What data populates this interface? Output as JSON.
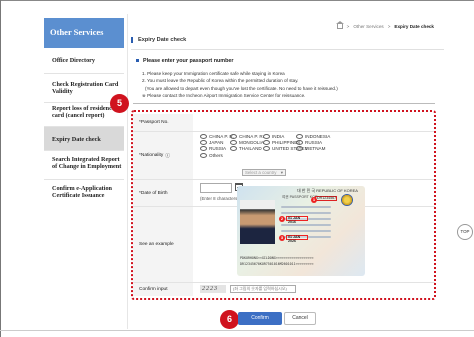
{
  "sidebar": {
    "title": "Other Services",
    "items": [
      {
        "label": "Office Directory"
      },
      {
        "label": "Check Registration Card Validity"
      },
      {
        "label": "Report loss of residence card (cancel report)"
      },
      {
        "label": "Expiry Date check",
        "active": true
      },
      {
        "label": "Search Integrated Report of Change in Employment"
      },
      {
        "label": "Confirm e-Application Certificate Issuance"
      }
    ]
  },
  "breadcrumb": {
    "sep1": ">",
    "item1": "Other Services",
    "sep2": ">",
    "current": "Expiry Date check"
  },
  "page_title": "Expiry Date check",
  "notice": {
    "heading": "Please enter your passport number",
    "lines": [
      "1. Please keep your Immigration certificate safe while staying in Korea",
      "2. You must leave the Republic of Korea within the permitted duration of stay.",
      "(You are allowed to depart even though you've lost the certificate. No need to have it reissued.)",
      "※ Please contact the Incheon Airport Immigration Service Center for reissuance."
    ]
  },
  "form": {
    "passport_label": "Passport No.",
    "nationality_label": "Nationality",
    "nationality_options": [
      "CHINA P. R.",
      "CHINA P. R.",
      "INDIA",
      "INDONESIA",
      "JAPAN",
      "MONGOLIA",
      "PHILIPPINES",
      "RUSSIA",
      "RUSSIA",
      "THAILAND",
      "UNITED STATES",
      "VIETNAM",
      "Others"
    ],
    "country_select_placeholder": "Select a country",
    "dob_label": "Date of Birth",
    "dob_hint": "(Enter 8 characters., ex: 19701123)",
    "example_label": "See an example",
    "confirm_input_label": "Confirm input",
    "captcha_text": "2223",
    "captcha_hint": "(좌 그림의 숫자를 입력하십시오)"
  },
  "passport_example": {
    "header": "대 한 민 국    REPUBLIC OF KOREA",
    "row2": "여권  PASSPORT   KOR",
    "number": "DR1234567",
    "markers": [
      "1",
      "2",
      "3"
    ],
    "field_values": [
      "01 JAN 2016",
      "01 JAN 2026"
    ],
    "mrz": [
      "PDKORHONG<<GILDONG<<<<<<<<<<<<<<<<<<<",
      "DR12345670KOR7501016M2601011<<<<<<<<<"
    ]
  },
  "steps": {
    "step5": "5",
    "step6": "6"
  },
  "buttons": {
    "confirm": "Confirm",
    "cancel": "Cancel",
    "top": "TOP"
  },
  "colors": {
    "accent": "#3c6fc4",
    "sidebar_head": "#5b8fd0",
    "highlight": "#d0121e"
  }
}
